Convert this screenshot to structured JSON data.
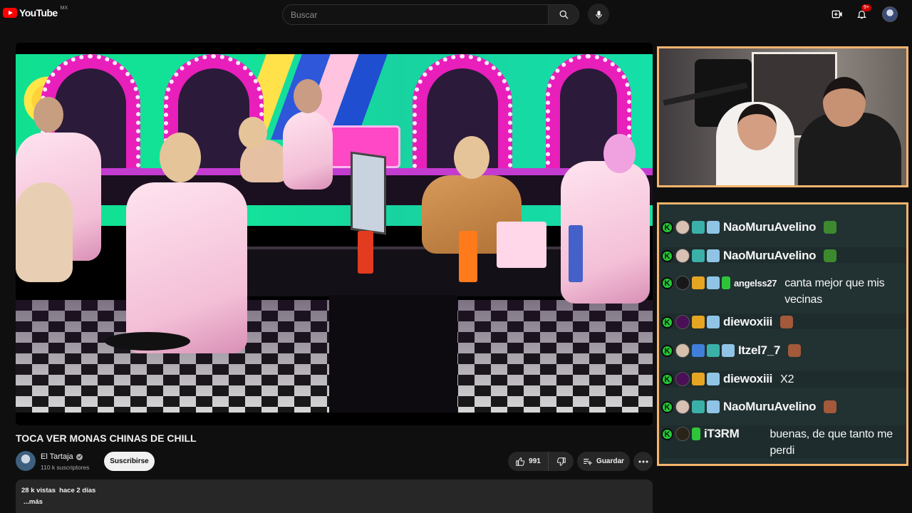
{
  "header": {
    "logo_text": "YouTube",
    "country": "MX",
    "search_placeholder": "Buscar",
    "notifications_count": "9+"
  },
  "video": {
    "title": "TOCA VER MONAS CHINAS DE CHILL",
    "channel_name": "El Tartaja",
    "subscribers": "110 k suscriptores",
    "subscribe_label": "Suscribirse",
    "likes": "991",
    "save_label": "Guardar",
    "views": "28 k vistas",
    "date": "hace 2 días",
    "more_label": "...más"
  },
  "chat": {
    "messages": [
      {
        "user": "NaoMuruAvelino",
        "text": "",
        "emote": "pepe"
      },
      {
        "user": "NaoMuruAvelino",
        "text": "",
        "emote": "pepe"
      },
      {
        "user": "angelss27",
        "text": "canta mejor que mis vecinas",
        "emote": ""
      },
      {
        "user": "diewoxiii",
        "text": "",
        "emote": "face"
      },
      {
        "user": "Itzel7_7",
        "text": "",
        "emote": "face"
      },
      {
        "user": "diewoxiii",
        "text": "X2",
        "emote": ""
      },
      {
        "user": "NaoMuruAvelino",
        "text": "",
        "emote": "face"
      },
      {
        "user": "iT3RM",
        "text": "buenas, de que tanto me perdi",
        "emote": ""
      }
    ],
    "badge_letter": "K",
    "colors": {
      "kick_green": "#23c937",
      "border": "#f6b46d",
      "bg": "#223132"
    }
  },
  "icons": {
    "search": "search-icon",
    "mic": "mic-icon",
    "create": "create-icon",
    "bell": "bell-icon",
    "like": "thumbs-up-icon",
    "dislike": "thumbs-down-icon",
    "save": "playlist-add-icon",
    "more": "more-horizontal-icon"
  }
}
